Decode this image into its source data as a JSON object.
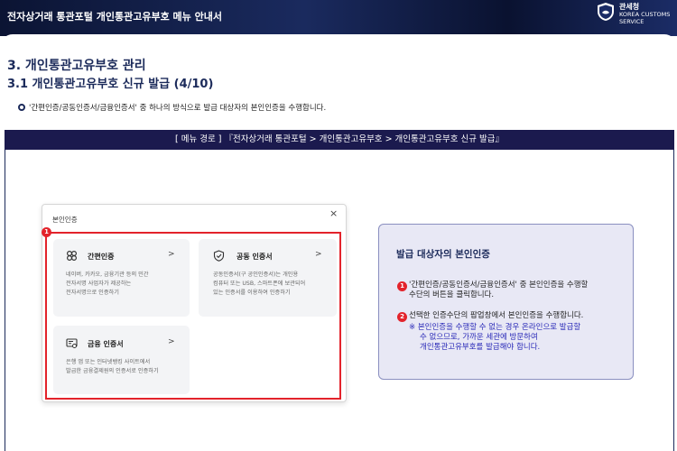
{
  "header": {
    "title": "전자상거래 통관포털 개인통관고유부호 메뉴 안내서",
    "org_korean": "관세청",
    "org_english": "KOREA CUSTOMS SERVICE"
  },
  "section": {
    "heading": "3. 개인통관고유부호 관리",
    "subheading": "3.1 개인통관고유부호 신규 발급 (4/10)",
    "bullet": "'간편인증/공동인증서/금융인증서' 중 하나의 방식으로 발급 대상자의 본인인증을 수행합니다."
  },
  "menu_path": "[ 메뉴 경로 ] 『전자상거래 통관포털 > 개인통관고유부호 > 개인통관고유부호 신규 발급』",
  "dialog": {
    "title": "본인인증",
    "close": "×",
    "marker": "1",
    "cards": [
      {
        "title": "간편인증",
        "chevron": ">",
        "icon": "link-icon",
        "desc": [
          "네이버, 카카오, 금융기관 등의 민간",
          "전자서명 사업자가 제공하는",
          "전자서명으로 인증하기"
        ]
      },
      {
        "title": "공동 인증서",
        "chevron": ">",
        "icon": "shield-check-icon",
        "desc": [
          "공동인증서(구 공인인증서)는 개인용",
          "컴퓨터 또는 USB, 스마트폰에 보관되어",
          "있는 인증서를 이용하여 인증하기"
        ]
      },
      {
        "title": "금융 인증서",
        "chevron": ">",
        "icon": "certificate-icon",
        "desc": [
          "은행 앱 또는 인터넷뱅킹 사이트에서",
          "발급한 금융결제원의 인증서로 인증하기"
        ]
      }
    ]
  },
  "panel": {
    "title": "발급 대상자의 본인인증",
    "step1_num": "1",
    "step1": [
      "'간편인증/공동인증서/금융인증서' 중 본인인증을 수행할",
      "수단의 버튼을 클릭합니다."
    ],
    "step2_num": "2",
    "step2": "선택한 인증수단의 팝업창에서 본인인증을 수행합니다.",
    "note": [
      "※ 본인인증을 수행할 수 없는 경우 온라인으로 발급할",
      "수 없으므로, 가까운 세관에 방문하여",
      "개인통관고유부호를 발급해야 합니다."
    ]
  },
  "colors": {
    "navy": "#1b2a5a",
    "red_highlight": "#e3232b",
    "note_blue": "#2a2ab8",
    "panel_bg": "#e8e8f5"
  }
}
